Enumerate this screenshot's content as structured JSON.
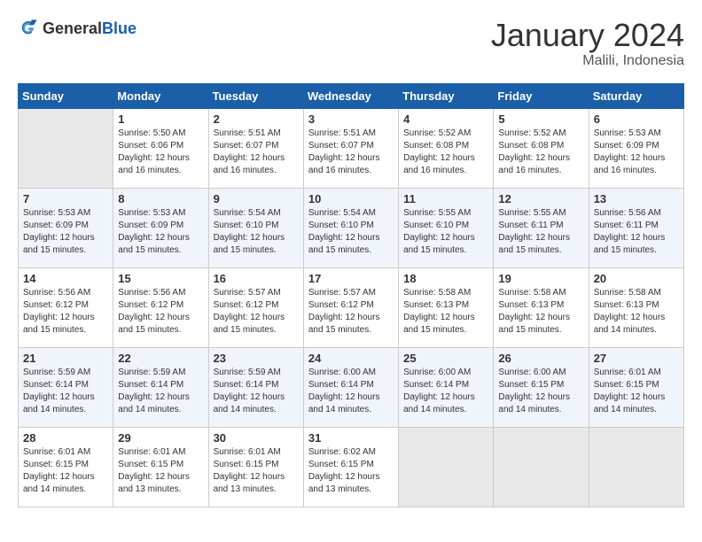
{
  "header": {
    "logo": {
      "general": "General",
      "blue": "Blue"
    },
    "title": "January 2024",
    "subtitle": "Malili, Indonesia"
  },
  "calendar": {
    "weekdays": [
      "Sunday",
      "Monday",
      "Tuesday",
      "Wednesday",
      "Thursday",
      "Friday",
      "Saturday"
    ],
    "weeks": [
      [
        {
          "day": null
        },
        {
          "day": 1,
          "sunrise": "5:50 AM",
          "sunset": "6:06 PM",
          "daylight": "12 hours and 16 minutes."
        },
        {
          "day": 2,
          "sunrise": "5:51 AM",
          "sunset": "6:07 PM",
          "daylight": "12 hours and 16 minutes."
        },
        {
          "day": 3,
          "sunrise": "5:51 AM",
          "sunset": "6:07 PM",
          "daylight": "12 hours and 16 minutes."
        },
        {
          "day": 4,
          "sunrise": "5:52 AM",
          "sunset": "6:08 PM",
          "daylight": "12 hours and 16 minutes."
        },
        {
          "day": 5,
          "sunrise": "5:52 AM",
          "sunset": "6:08 PM",
          "daylight": "12 hours and 16 minutes."
        },
        {
          "day": 6,
          "sunrise": "5:53 AM",
          "sunset": "6:09 PM",
          "daylight": "12 hours and 16 minutes."
        }
      ],
      [
        {
          "day": 7,
          "sunrise": "5:53 AM",
          "sunset": "6:09 PM",
          "daylight": "12 hours and 15 minutes."
        },
        {
          "day": 8,
          "sunrise": "5:53 AM",
          "sunset": "6:09 PM",
          "daylight": "12 hours and 15 minutes."
        },
        {
          "day": 9,
          "sunrise": "5:54 AM",
          "sunset": "6:10 PM",
          "daylight": "12 hours and 15 minutes."
        },
        {
          "day": 10,
          "sunrise": "5:54 AM",
          "sunset": "6:10 PM",
          "daylight": "12 hours and 15 minutes."
        },
        {
          "day": 11,
          "sunrise": "5:55 AM",
          "sunset": "6:10 PM",
          "daylight": "12 hours and 15 minutes."
        },
        {
          "day": 12,
          "sunrise": "5:55 AM",
          "sunset": "6:11 PM",
          "daylight": "12 hours and 15 minutes."
        },
        {
          "day": 13,
          "sunrise": "5:56 AM",
          "sunset": "6:11 PM",
          "daylight": "12 hours and 15 minutes."
        }
      ],
      [
        {
          "day": 14,
          "sunrise": "5:56 AM",
          "sunset": "6:12 PM",
          "daylight": "12 hours and 15 minutes."
        },
        {
          "day": 15,
          "sunrise": "5:56 AM",
          "sunset": "6:12 PM",
          "daylight": "12 hours and 15 minutes."
        },
        {
          "day": 16,
          "sunrise": "5:57 AM",
          "sunset": "6:12 PM",
          "daylight": "12 hours and 15 minutes."
        },
        {
          "day": 17,
          "sunrise": "5:57 AM",
          "sunset": "6:12 PM",
          "daylight": "12 hours and 15 minutes."
        },
        {
          "day": 18,
          "sunrise": "5:58 AM",
          "sunset": "6:13 PM",
          "daylight": "12 hours and 15 minutes."
        },
        {
          "day": 19,
          "sunrise": "5:58 AM",
          "sunset": "6:13 PM",
          "daylight": "12 hours and 15 minutes."
        },
        {
          "day": 20,
          "sunrise": "5:58 AM",
          "sunset": "6:13 PM",
          "daylight": "12 hours and 14 minutes."
        }
      ],
      [
        {
          "day": 21,
          "sunrise": "5:59 AM",
          "sunset": "6:14 PM",
          "daylight": "12 hours and 14 minutes."
        },
        {
          "day": 22,
          "sunrise": "5:59 AM",
          "sunset": "6:14 PM",
          "daylight": "12 hours and 14 minutes."
        },
        {
          "day": 23,
          "sunrise": "5:59 AM",
          "sunset": "6:14 PM",
          "daylight": "12 hours and 14 minutes."
        },
        {
          "day": 24,
          "sunrise": "6:00 AM",
          "sunset": "6:14 PM",
          "daylight": "12 hours and 14 minutes."
        },
        {
          "day": 25,
          "sunrise": "6:00 AM",
          "sunset": "6:14 PM",
          "daylight": "12 hours and 14 minutes."
        },
        {
          "day": 26,
          "sunrise": "6:00 AM",
          "sunset": "6:15 PM",
          "daylight": "12 hours and 14 minutes."
        },
        {
          "day": 27,
          "sunrise": "6:01 AM",
          "sunset": "6:15 PM",
          "daylight": "12 hours and 14 minutes."
        }
      ],
      [
        {
          "day": 28,
          "sunrise": "6:01 AM",
          "sunset": "6:15 PM",
          "daylight": "12 hours and 14 minutes."
        },
        {
          "day": 29,
          "sunrise": "6:01 AM",
          "sunset": "6:15 PM",
          "daylight": "12 hours and 13 minutes."
        },
        {
          "day": 30,
          "sunrise": "6:01 AM",
          "sunset": "6:15 PM",
          "daylight": "12 hours and 13 minutes."
        },
        {
          "day": 31,
          "sunrise": "6:02 AM",
          "sunset": "6:15 PM",
          "daylight": "12 hours and 13 minutes."
        },
        {
          "day": null
        },
        {
          "day": null
        },
        {
          "day": null
        }
      ]
    ]
  }
}
